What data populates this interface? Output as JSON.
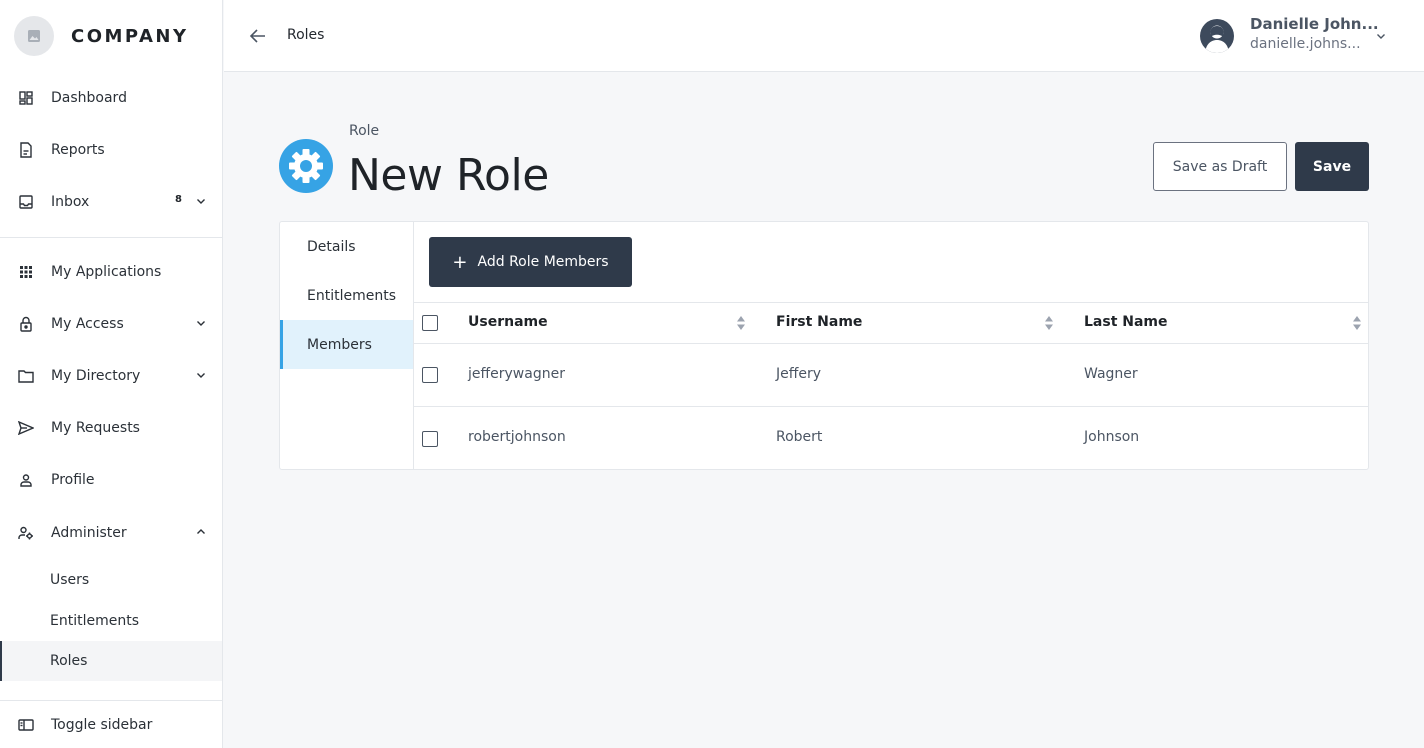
{
  "brand": {
    "name": "COMPANY"
  },
  "sidebar": {
    "items": [
      {
        "label": "Dashboard",
        "icon": "dashboard-icon"
      },
      {
        "label": "Reports",
        "icon": "reports-icon"
      },
      {
        "label": "Inbox",
        "icon": "inbox-icon",
        "badge": "8"
      },
      {
        "label": "My Applications",
        "icon": "grid-icon"
      },
      {
        "label": "My Access",
        "icon": "lock-icon"
      },
      {
        "label": "My Directory",
        "icon": "folder-icon"
      },
      {
        "label": "My Requests",
        "icon": "send-icon"
      },
      {
        "label": "Profile",
        "icon": "user-icon"
      },
      {
        "label": "Administer",
        "icon": "admin-icon"
      }
    ],
    "administer_sub": [
      {
        "label": "Users"
      },
      {
        "label": "Entitlements"
      },
      {
        "label": "Roles"
      }
    ],
    "toggle_label": "Toggle sidebar"
  },
  "header": {
    "breadcrumb": "Roles",
    "user_name": "Danielle John...",
    "user_email": "danielle.johns..."
  },
  "page": {
    "subtitle": "Role",
    "title": "New Role",
    "save_draft_label": "Save as Draft",
    "save_label": "Save"
  },
  "tabs": [
    {
      "label": "Details"
    },
    {
      "label": "Entitlements"
    },
    {
      "label": "Members"
    }
  ],
  "members": {
    "add_label": "Add Role Members",
    "columns": [
      "Username",
      "First Name",
      "Last Name"
    ],
    "rows": [
      {
        "username": "jefferywagner",
        "first": "Jeffery",
        "last": "Wagner"
      },
      {
        "username": "robertjohnson",
        "first": "Robert",
        "last": "Johnson"
      }
    ]
  },
  "colors": {
    "accent": "#36a3e5",
    "primary_button": "#2f3a4a",
    "active_tab_bg": "#e1f2fc"
  }
}
